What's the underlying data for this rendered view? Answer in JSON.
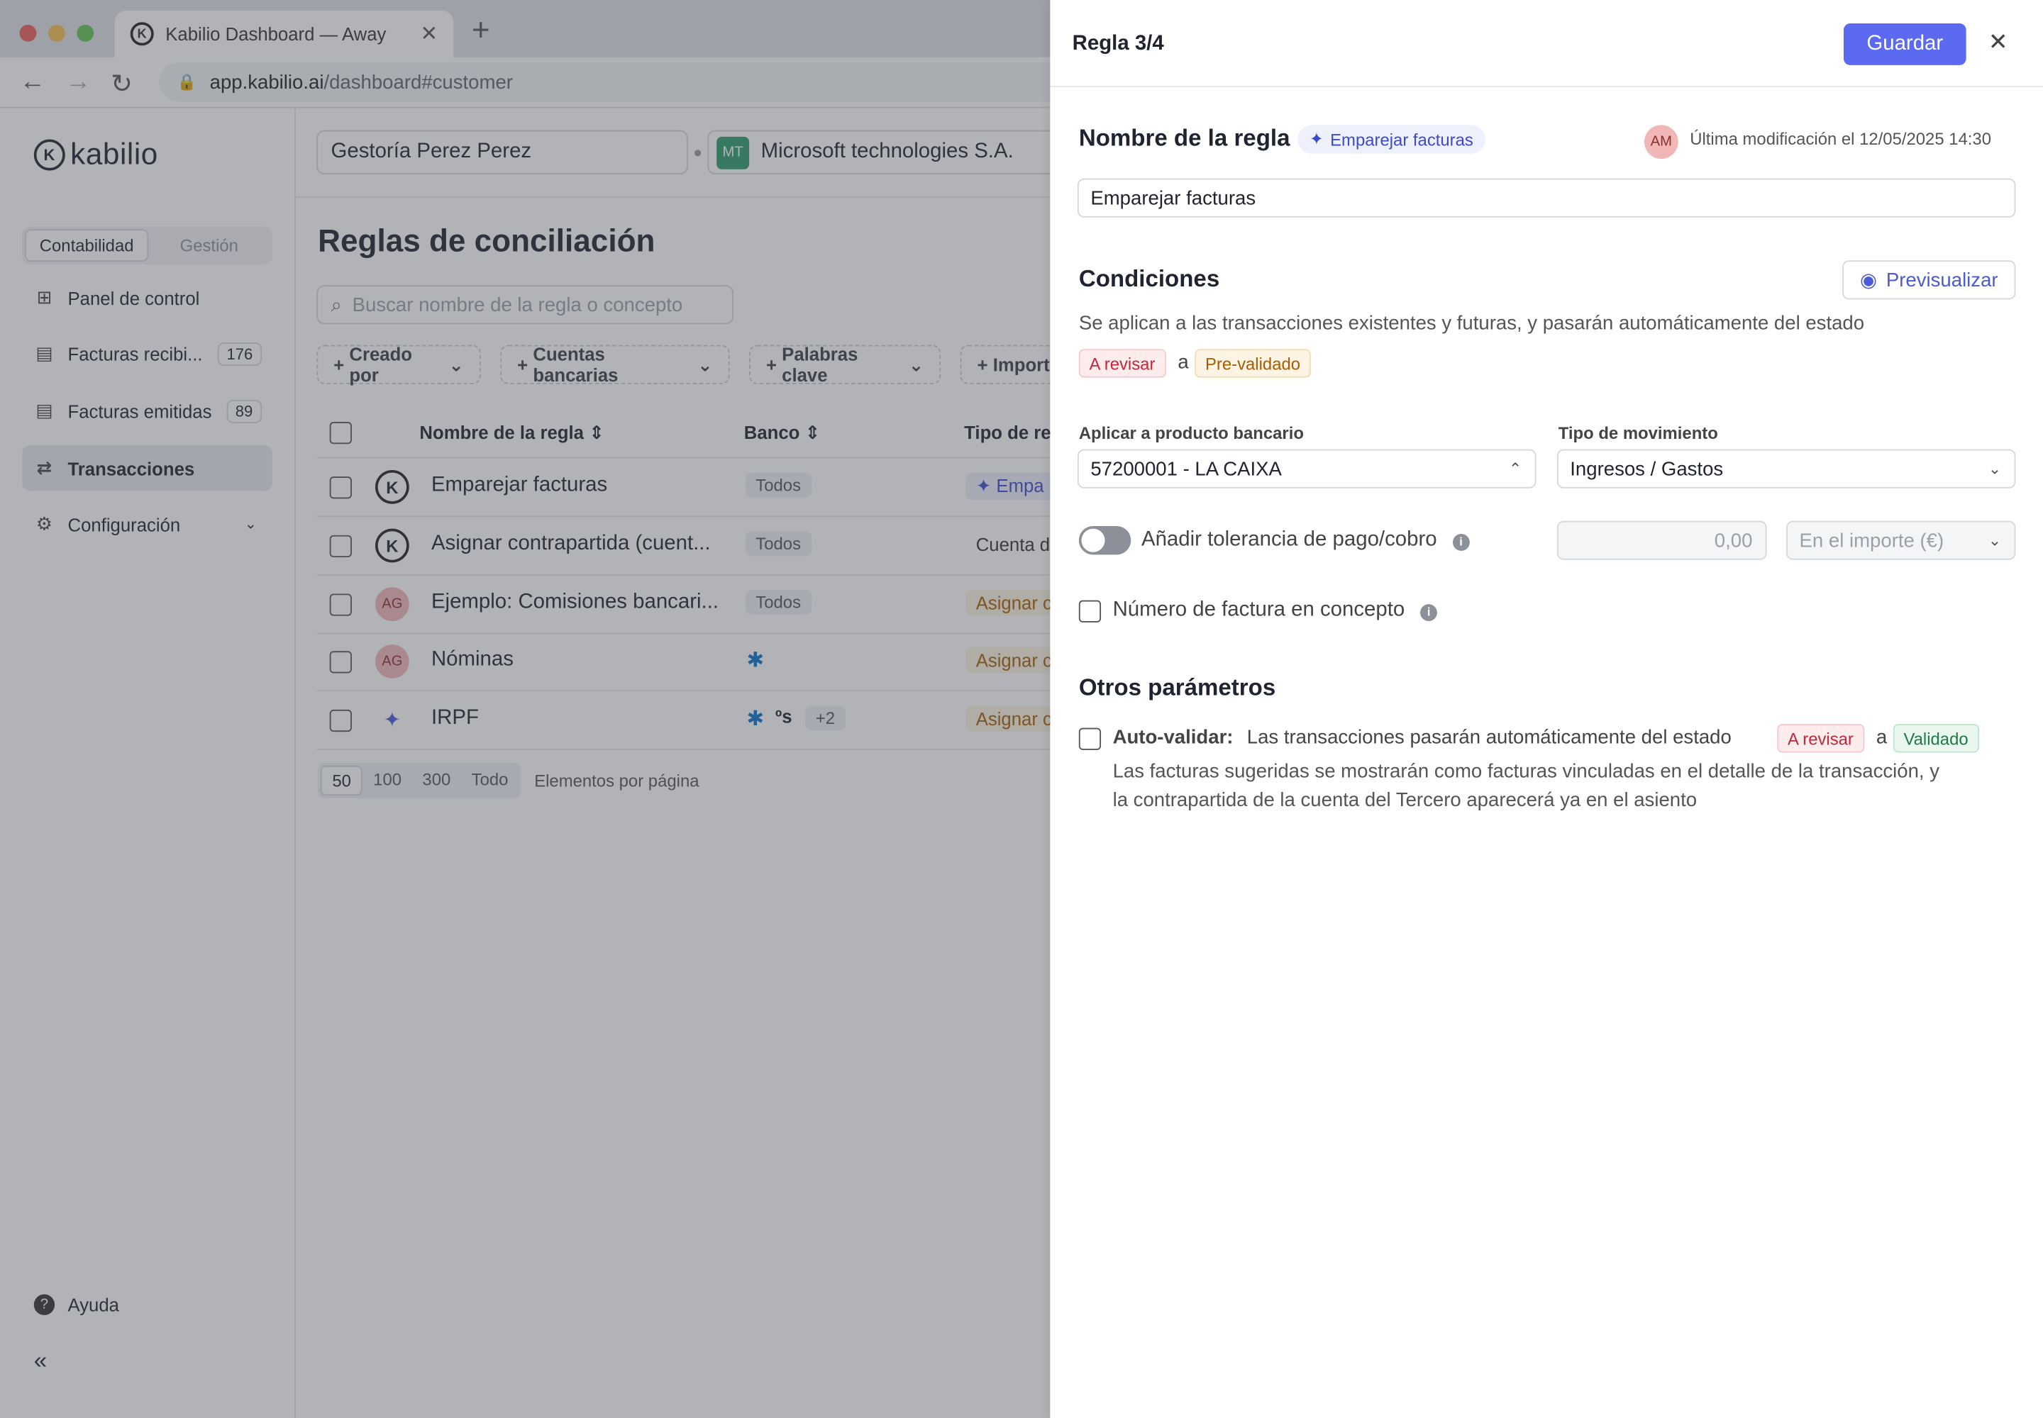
{
  "browser": {
    "tab_title": "Kabilio Dashboard — Away",
    "url_host": "app.kabilio.ai",
    "url_path": "/dashboard#customer"
  },
  "sidebar": {
    "brand": "kabilio",
    "segments": [
      "Contabilidad",
      "Gestión"
    ],
    "items": [
      {
        "label": "Panel de control",
        "icon": "grid-icon"
      },
      {
        "label": "Facturas recibi...",
        "count": "176",
        "icon": "invoice-in-icon"
      },
      {
        "label": "Facturas emitidas",
        "count": "89",
        "icon": "invoice-out-icon"
      },
      {
        "label": "Transacciones",
        "icon": "arrows-icon"
      },
      {
        "label": "Configuración",
        "icon": "gear-icon"
      }
    ],
    "help": "Ayuda"
  },
  "topbar": {
    "company": "Gestoría Perez Perez",
    "client_initials": "MT",
    "client": "Microsoft technologies S.A."
  },
  "page": {
    "title": "Reglas de conciliación",
    "search_placeholder": "Buscar nombre de la regla o concepto",
    "filters": [
      "Creado por",
      "Cuentas bancarias",
      "Palabras clave",
      "Import"
    ],
    "columns": [
      "Nombre de la regla",
      "Banco",
      "Tipo de reg"
    ],
    "rows": [
      {
        "name": "Emparejar facturas",
        "bank": "Todos",
        "type": "Empa",
        "avatar": "K"
      },
      {
        "name": "Asignar contrapartida (cuent...",
        "bank": "Todos",
        "type": "Cuenta d",
        "avatar": "K"
      },
      {
        "name": "Ejemplo: Comisiones bancari...",
        "bank": "Todos",
        "type": "Asignar c",
        "avatar": "AG"
      },
      {
        "name": "Nóminas",
        "bank": "",
        "type": "Asignar c",
        "avatar": "AG"
      },
      {
        "name": "IRPF",
        "bank": "+2",
        "type": "Asignar c",
        "avatar": ""
      }
    ],
    "pager": [
      "50",
      "100",
      "300",
      "Todo"
    ],
    "pager_label": "Elementos por página"
  },
  "panel": {
    "title": "Regla 3/4",
    "save": "Guardar",
    "name_section": "Nombre de la regla",
    "name_tag": "Emparejar facturas",
    "author_initials": "AM",
    "modified": "Última modificación el 12/05/2025 14:30",
    "name_value": "Emparejar facturas",
    "conditions_title": "Condiciones",
    "preview": "Previsualizar",
    "conditions_desc": "Se aplican a las transacciones existentes y futuras, y pasarán automáticamente del  estado",
    "state_from": "A revisar",
    "connector": "a",
    "state_to": "Pre-validado",
    "bank_label": "Aplicar a producto bancario",
    "bank_value": "57200001 - LA CAIXA",
    "move_label": "Tipo de movimiento",
    "move_value": "Ingresos / Gastos",
    "tolerance_label": "Añadir tolerancia de pago/cobro",
    "tolerance_value": "0,00",
    "tolerance_unit": "En el importe (€)",
    "invoice_in_concept": "Número de factura en concepto",
    "other_title": "Otros parámetros",
    "autovalidate_bold": "Auto-validar:",
    "autovalidate_text": "Las transacciones pasarán automáticamente del estado",
    "auto_from": "A revisar",
    "auto_to": "Validado",
    "auto_line2": "Las facturas sugeridas se mostrarán como facturas vinculadas en el detalle de la transacción, y",
    "auto_line3": "la contrapartida de la cuenta del Tercero aparecerá ya en el asiento"
  },
  "colors": {
    "accent": "#5b6af0",
    "danger": "#c2273a",
    "warning": "#a85d00",
    "success": "#21794a"
  }
}
